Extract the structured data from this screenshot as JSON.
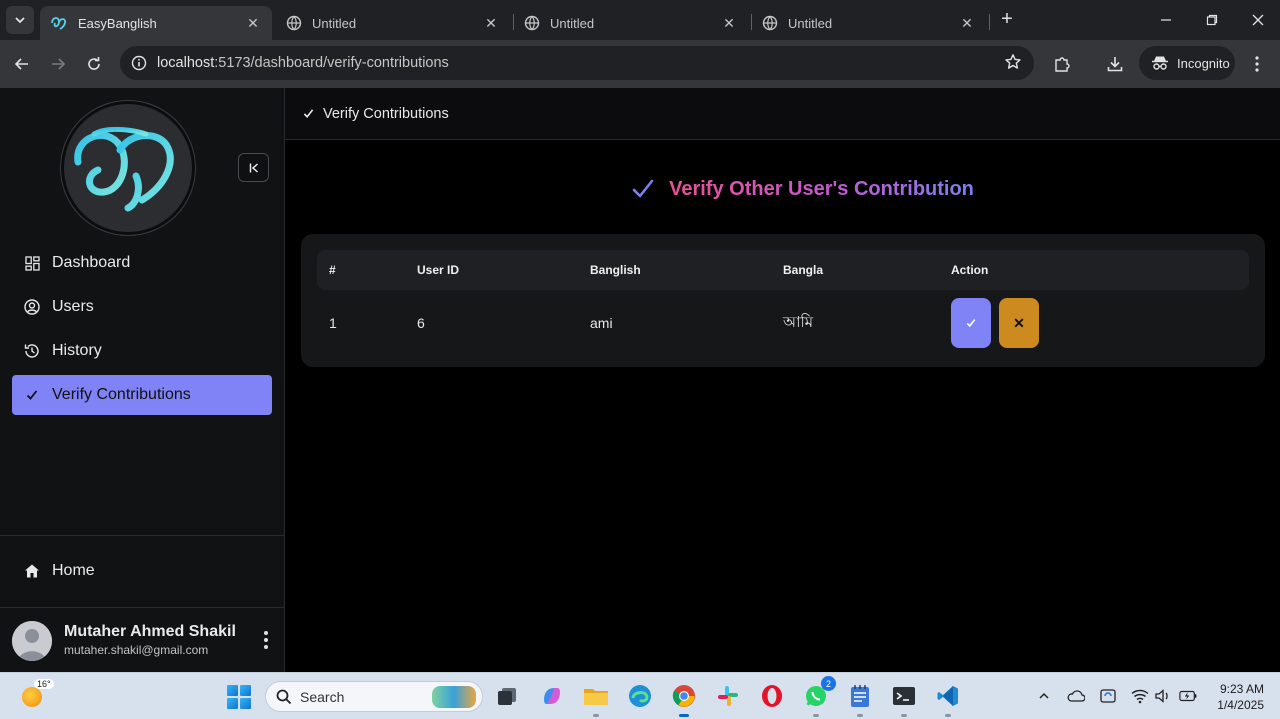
{
  "browser": {
    "tabs": [
      {
        "title": "EasyBanglish",
        "active": true
      },
      {
        "title": "Untitled",
        "active": false
      },
      {
        "title": "Untitled",
        "active": false
      },
      {
        "title": "Untitled",
        "active": false
      }
    ],
    "url_host": "localhost",
    "url_path": ":5173/dashboard/verify-contributions",
    "incognito_label": "Incognito"
  },
  "sidebar": {
    "items": [
      {
        "label": "Dashboard",
        "icon": "dashboard-icon"
      },
      {
        "label": "Users",
        "icon": "user-circle-icon"
      },
      {
        "label": "History",
        "icon": "history-icon"
      },
      {
        "label": "Verify Contributions",
        "icon": "check-icon",
        "active": true
      }
    ],
    "home_label": "Home",
    "user": {
      "name": "Mutaher Ahmed Shakil",
      "email": "mutaher.shakil@gmail.com"
    }
  },
  "main": {
    "breadcrumb": "Verify Contributions",
    "heading": "Verify Other User's Contribution",
    "table": {
      "columns": [
        "#",
        "User ID",
        "Banglish",
        "Bangla",
        "Action"
      ],
      "rows": [
        {
          "index": "1",
          "user_id": "6",
          "banglish": "ami",
          "bangla": "আমি"
        }
      ],
      "reject_symbol": "✕"
    }
  },
  "taskbar": {
    "weather_temp": "16°",
    "search_placeholder": "Search",
    "whatsapp_badge": "2",
    "time": "9:23 AM",
    "date": "1/4/2025"
  },
  "colors": {
    "accent": "#7f83f5",
    "reject": "#cc8a1f",
    "heading_gradient_start": "#ec4f93",
    "heading_gradient_end": "#7c7ff0"
  }
}
